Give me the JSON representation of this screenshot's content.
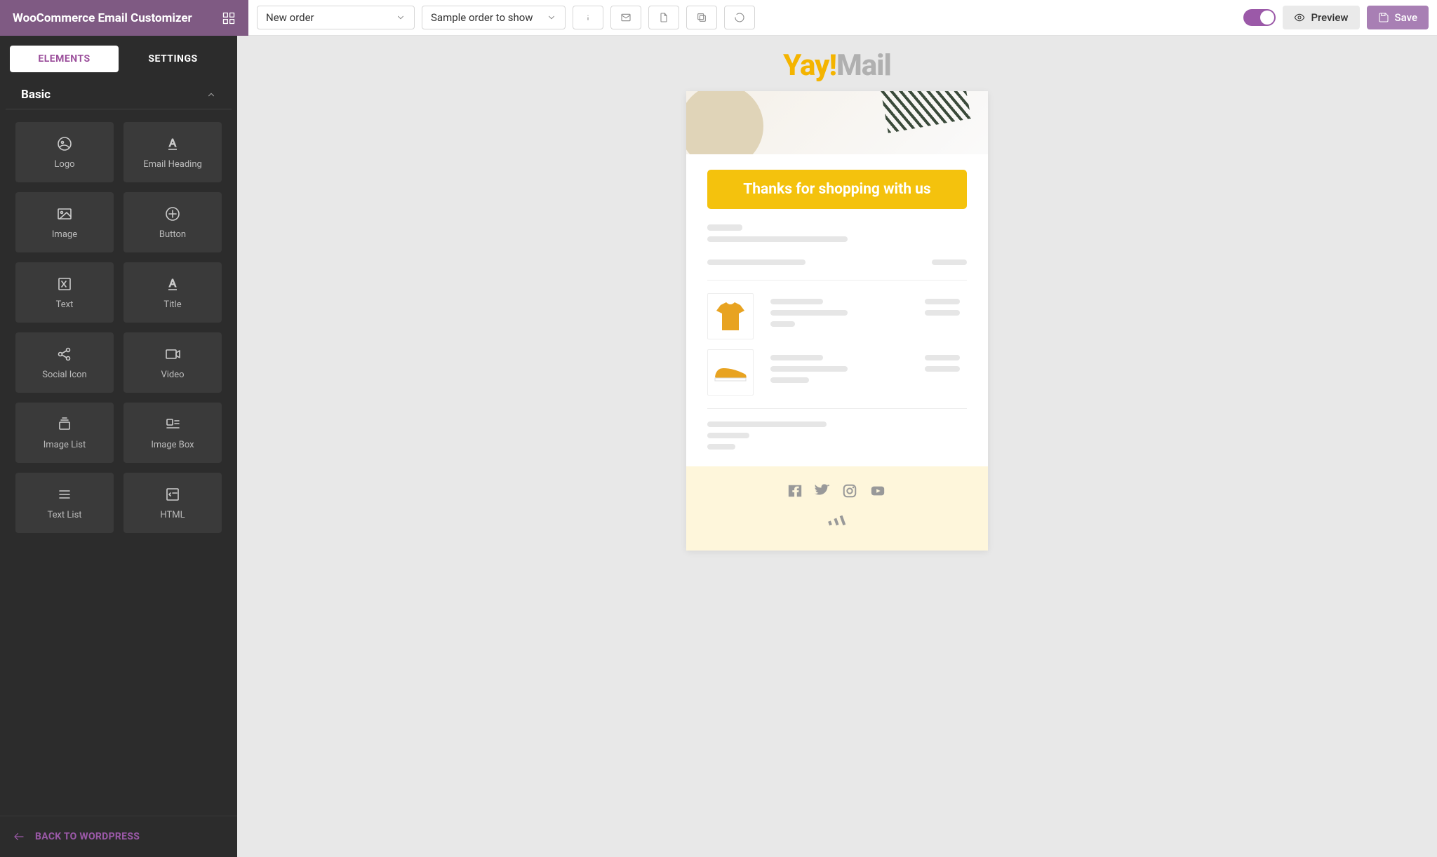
{
  "header": {
    "app_title": "WooCommerce Email Customizer"
  },
  "toolbar": {
    "select_template": "New order",
    "select_order": "Sample order to show",
    "preview_label": "Preview",
    "save_label": "Save"
  },
  "sidebar": {
    "tab_elements": "ELEMENTS",
    "tab_settings": "SETTINGS",
    "section_basic": "Basic",
    "back_label": "BACK TO WORDPRESS",
    "elements": [
      {
        "id": "logo",
        "label": "Logo"
      },
      {
        "id": "email-heading",
        "label": "Email Heading"
      },
      {
        "id": "image",
        "label": "Image"
      },
      {
        "id": "button",
        "label": "Button"
      },
      {
        "id": "text",
        "label": "Text"
      },
      {
        "id": "title",
        "label": "Title"
      },
      {
        "id": "social-icon",
        "label": "Social Icon"
      },
      {
        "id": "video",
        "label": "Video"
      },
      {
        "id": "image-list",
        "label": "Image List"
      },
      {
        "id": "image-box",
        "label": "Image Box"
      },
      {
        "id": "text-list",
        "label": "Text List"
      },
      {
        "id": "html",
        "label": "HTML"
      }
    ]
  },
  "email": {
    "logo_yay": "Yay",
    "logo_bang": "!",
    "logo_mail": "Mail",
    "banner_text": "Thanks for shopping with us"
  },
  "colors": {
    "brand_purple": "#7f5a83",
    "accent_yellow": "#f4c20d",
    "save_purple": "#a87fb4"
  }
}
